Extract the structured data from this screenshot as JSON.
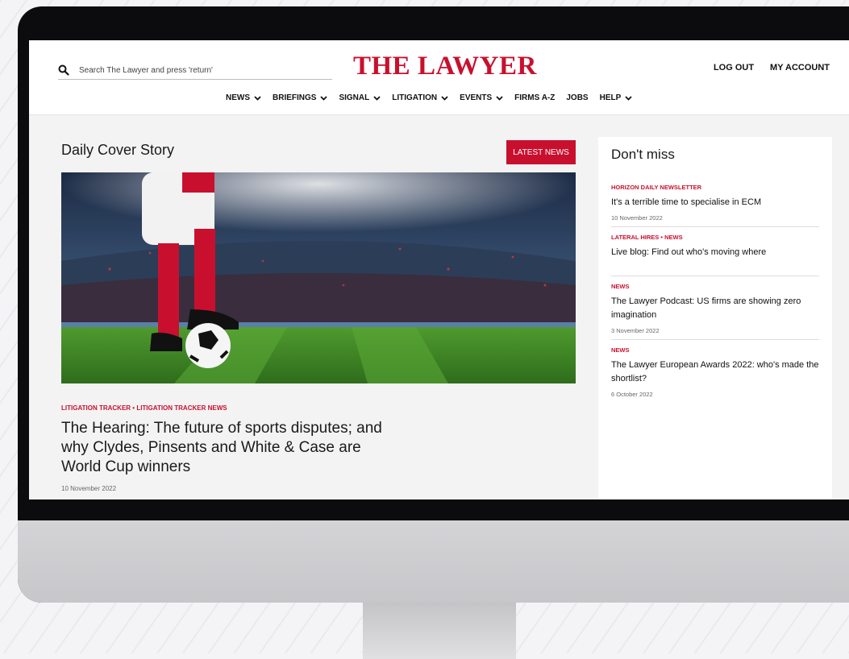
{
  "header": {
    "search": {
      "placeholder": "Search The Lawyer and press 'return'",
      "icon": "search-icon"
    },
    "logo": "THE LAWYER",
    "account_links": [
      "LOG OUT",
      "MY ACCOUNT"
    ],
    "nav": [
      {
        "label": "NEWS",
        "dropdown": true
      },
      {
        "label": "BRIEFINGS",
        "dropdown": true
      },
      {
        "label": "SIGNAL",
        "dropdown": true
      },
      {
        "label": "LITIGATION",
        "dropdown": true
      },
      {
        "label": "EVENTS",
        "dropdown": true
      },
      {
        "label": "FIRMS A-Z",
        "dropdown": false
      },
      {
        "label": "JOBS",
        "dropdown": false
      },
      {
        "label": "HELP",
        "dropdown": true
      }
    ]
  },
  "main": {
    "section_title": "Daily Cover Story",
    "latest_news_button": "LATEST NEWS",
    "story": {
      "tags": "LITIGATION TRACKER • LITIGATION TRACKER NEWS",
      "headline": "The Hearing: The future of sports disputes; and why Clydes, Pinsents and White & Case are World Cup winners",
      "date": "10 November 2022"
    }
  },
  "sidebar": {
    "title": "Don't miss",
    "items": [
      {
        "tag": "HORIZON DAILY NEWSLETTER",
        "headline": "It's a terrible time to specialise in ECM",
        "date": "10 November 2022"
      },
      {
        "tag": "LATERAL HIRES • NEWS",
        "headline": "Live blog: Find out who's moving where",
        "date": ""
      },
      {
        "tag": "NEWS",
        "headline": "The Lawyer Podcast: US firms are showing zero imagination",
        "date": "3 November 2022"
      },
      {
        "tag": "NEWS",
        "headline": "The Lawyer European Awards 2022: who's made the shortlist?",
        "date": "6 October 2022"
      }
    ]
  },
  "colors": {
    "brand_red": "#c8102e",
    "text": "#1a1a1a",
    "page_bg": "#f3f3f3"
  }
}
